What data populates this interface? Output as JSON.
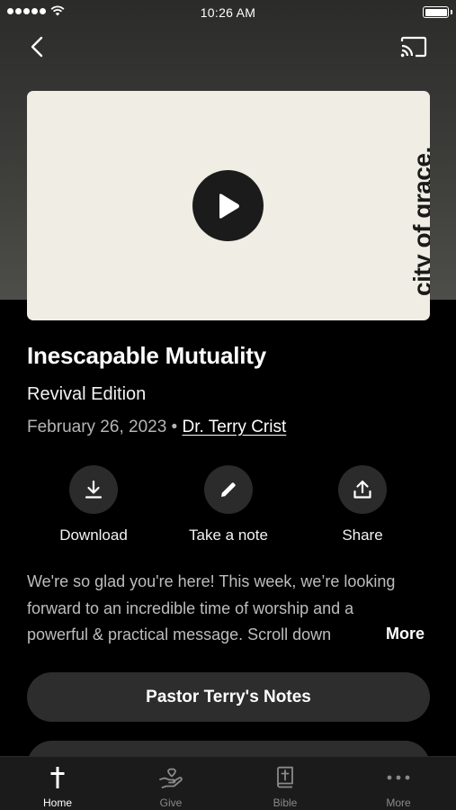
{
  "status_bar": {
    "time": "10:26 AM"
  },
  "nav": {
    "back_icon": "chevron-left-icon",
    "cast_icon": "cast-icon"
  },
  "media": {
    "brand_text": "city of grace.",
    "play_icon": "play-icon"
  },
  "sermon": {
    "title": "Inescapable Mutuality",
    "subtitle": "Revival Edition",
    "date": "February 26, 2023",
    "separator": "•",
    "speaker": "Dr. Terry Crist"
  },
  "actions": [
    {
      "label": "Download",
      "icon": "download-icon"
    },
    {
      "label": "Take a note",
      "icon": "pencil-icon"
    },
    {
      "label": "Share",
      "icon": "share-icon"
    }
  ],
  "description": {
    "text": "We're so glad you're here! This week, we’re looking forward to an incredible time of worship and a powerful & practical message. Scroll down",
    "more_label": "More"
  },
  "notes_button": {
    "label": "Pastor Terry's Notes"
  },
  "tab_bar": {
    "tabs": [
      {
        "label": "Home",
        "icon": "cross-icon",
        "active": true
      },
      {
        "label": "Give",
        "icon": "giving-hand-icon",
        "active": false
      },
      {
        "label": "Bible",
        "icon": "bible-icon",
        "active": false
      },
      {
        "label": "More",
        "icon": "more-dots-icon",
        "active": false
      }
    ]
  },
  "colors": {
    "background": "#000000",
    "card": "#efede4",
    "button_bg": "#2d2d2d",
    "tab_bar_bg": "#1b1b1b"
  }
}
